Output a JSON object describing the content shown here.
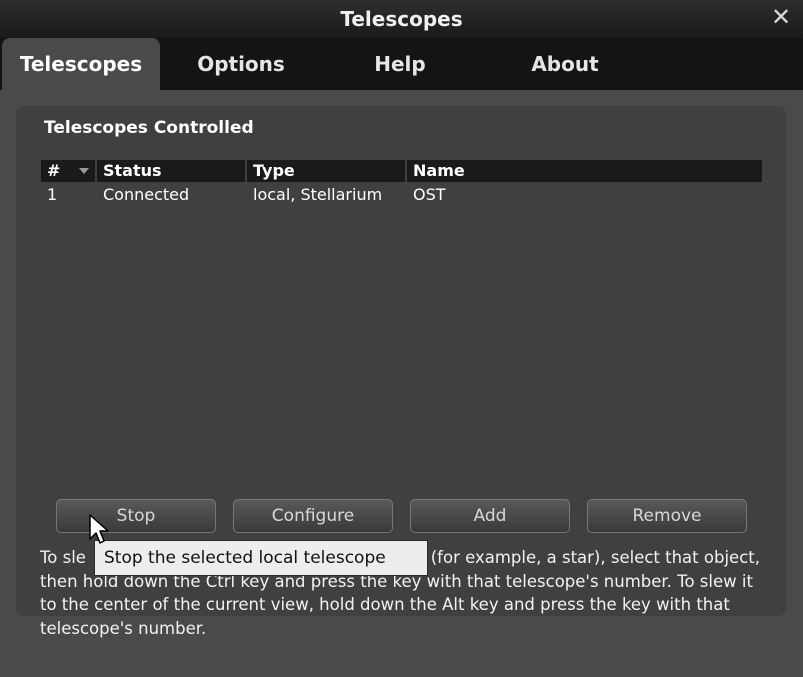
{
  "window": {
    "title": "Telescopes"
  },
  "tabs": [
    {
      "label": "Telescopes",
      "active": true
    },
    {
      "label": "Options",
      "active": false
    },
    {
      "label": "Help",
      "active": false
    },
    {
      "label": "About",
      "active": false
    }
  ],
  "section": {
    "title": "Telescopes Controlled"
  },
  "table": {
    "columns": [
      "#",
      "Status",
      "Type",
      "Name"
    ],
    "rows": [
      {
        "num": "1",
        "status": "Connected",
        "type": "local, Stellarium",
        "name": "OST"
      }
    ]
  },
  "buttons": {
    "stop": "Stop",
    "configure": "Configure",
    "add": "Add",
    "remove": "Remove"
  },
  "tooltip": "Stop the selected local telescope",
  "help": {
    "before_tooltip": "To sle",
    "after_tooltip": "ct (for example, a star), select that object, then hold down the Ctrl key and press the key with that telescope's number. To slew it to the center of the current view, hold down the Alt key and press the key with that telescope's number."
  },
  "colors": {
    "panel": "#4a4a4a",
    "header": "#1a1a1a",
    "tooltip_bg": "#ededed"
  },
  "icons": [
    "close-icon",
    "sort-icon",
    "cursor-icon"
  ]
}
